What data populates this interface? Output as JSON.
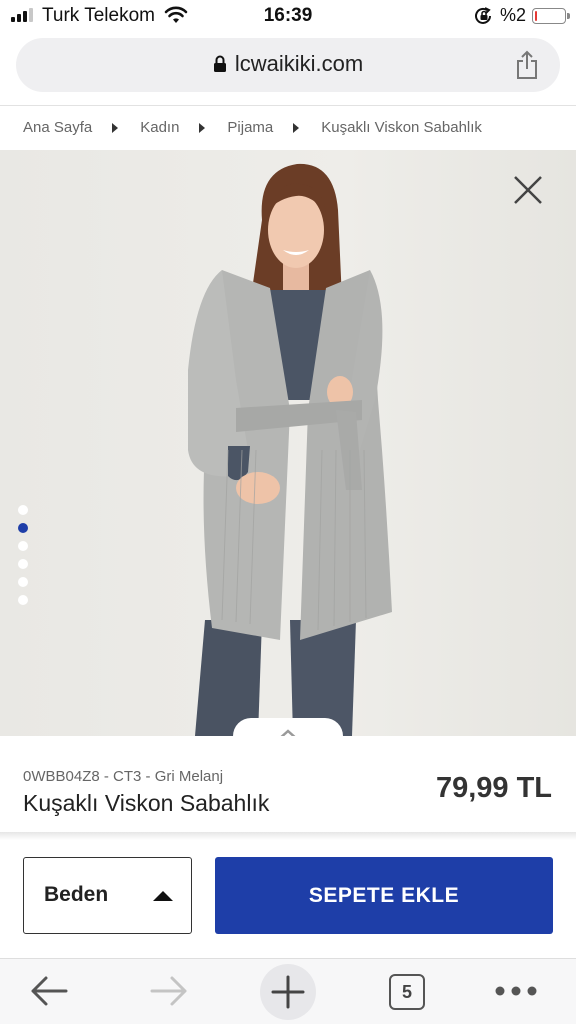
{
  "status_bar": {
    "carrier": "Turk Telekom",
    "time": "16:39",
    "battery_percent": "%2",
    "battery_level": 0.05,
    "battery_color": "#e53935",
    "icons": [
      "signal-icon",
      "wifi-icon",
      "rotation-lock-icon",
      "battery-icon"
    ]
  },
  "browser": {
    "url": "lcwaikiki.com",
    "tab_count": "5",
    "icons": [
      "lock-icon",
      "share-icon",
      "back-arrow-icon",
      "forward-arrow-icon",
      "new-tab-plus-icon",
      "tabs-icon",
      "more-icon"
    ]
  },
  "breadcrumb": [
    "Ana Sayfa",
    "Kadın",
    "Pijama",
    "Kuşaklı Viskon Sabahlık"
  ],
  "gallery": {
    "dot_count": 6,
    "active_dot": 1,
    "icons": [
      "close-icon",
      "chevron-up-icon"
    ]
  },
  "product": {
    "code": "0WBB04Z8 - CT3 - Gri Melanj",
    "name": "Kuşaklı Viskon Sabahlık",
    "price": "79,99 TL"
  },
  "actions": {
    "size_label": "Beden",
    "add_to_cart_label": "SEPETE EKLE"
  },
  "colors": {
    "accent": "#1e3ea8",
    "robe_gray": "#b5b6b4",
    "pants_navy": "#4a5362"
  }
}
